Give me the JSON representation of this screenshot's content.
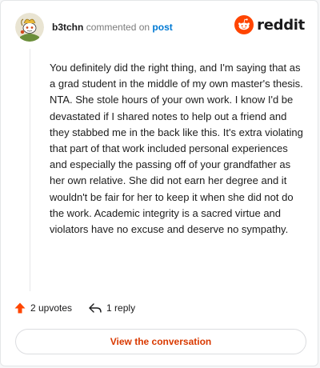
{
  "header": {
    "username": "b3tchn",
    "action_text": "commented on",
    "post_link": "post",
    "avatar_icon": "snoo-avatar-icon",
    "brand_icon": "reddit-alien-icon",
    "brand_name": "reddit"
  },
  "comment": {
    "text": "You definitely did the right thing, and I'm saying that as a grad student in the middle of my own master's thesis. NTA. She stole hours of your own work. I know I'd be devastated if I shared notes to help out a friend and they stabbed me in the back like this. It's extra violating that part of that work included personal experiences and especially the passing off of your grandfather as her own relative. She did not earn her degree and it wouldn't be fair for her to keep it when she did not do the work. Academic integrity is a sacred virtue and violators have no excuse and deserve no sympathy."
  },
  "actions": {
    "upvotes_label": "2 upvotes",
    "reply_label": "1 reply",
    "upvote_icon": "upvote-arrow-icon",
    "reply_icon": "reply-arrow-icon"
  },
  "footer": {
    "button_label": "View the conversation"
  },
  "colors": {
    "brand_orange": "#ff4500",
    "link_blue": "#0079d3",
    "button_text": "#d93900",
    "text": "#1c1c1c",
    "muted": "#7c7c7c"
  }
}
